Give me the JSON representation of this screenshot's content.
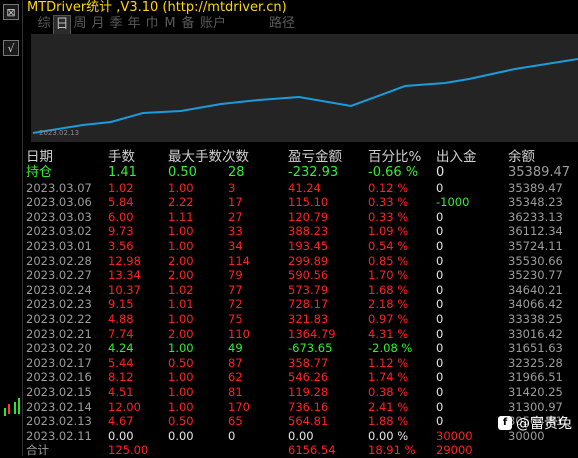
{
  "app_title": "MTDriver统计  ,V3.10 (http://mtdriver.cn)",
  "tabs": [
    "综",
    "日",
    "周",
    "月",
    "季",
    "年",
    "巾",
    "M",
    "备",
    "账户",
    "路径"
  ],
  "active_tab": "日",
  "chart": {
    "date_label": "2023.02.13"
  },
  "table": {
    "headers": [
      "日期",
      "手数",
      "最大手数",
      "次数",
      "盈亏金额",
      "百分比%",
      "出入金",
      "余额"
    ],
    "holding": {
      "label": "持仓",
      "lots": "1.41",
      "max_lots": "0.50",
      "count": "28",
      "pnl": "-232.93",
      "pct": "-0.66 %",
      "flow": "0",
      "balance": "35389.47"
    },
    "rows": [
      {
        "date": "2023.03.07",
        "lots": "1.02",
        "max_lots": "1.00",
        "count": "3",
        "pnl": "41.24",
        "pct": "0.12 %",
        "flow": "0",
        "balance": "35389.47"
      },
      {
        "date": "2023.03.06",
        "lots": "5.84",
        "max_lots": "2.22",
        "count": "17",
        "pnl": "115.10",
        "pct": "0.33 %",
        "flow": "-1000",
        "balance": "35348.23"
      },
      {
        "date": "2023.03.03",
        "lots": "6.00",
        "max_lots": "1.11",
        "count": "27",
        "pnl": "120.79",
        "pct": "0.33 %",
        "flow": "0",
        "balance": "36233.13"
      },
      {
        "date": "2023.03.02",
        "lots": "9.73",
        "max_lots": "1.00",
        "count": "33",
        "pnl": "388.23",
        "pct": "1.09 %",
        "flow": "0",
        "balance": "36112.34"
      },
      {
        "date": "2023.03.01",
        "lots": "3.56",
        "max_lots": "1.00",
        "count": "34",
        "pnl": "193.45",
        "pct": "0.54 %",
        "flow": "0",
        "balance": "35724.11"
      },
      {
        "date": "2023.02.28",
        "lots": "12.98",
        "max_lots": "2.00",
        "count": "114",
        "pnl": "299.89",
        "pct": "0.85 %",
        "flow": "0",
        "balance": "35530.66"
      },
      {
        "date": "2023.02.27",
        "lots": "13.34",
        "max_lots": "2.00",
        "count": "79",
        "pnl": "590.56",
        "pct": "1.70 %",
        "flow": "0",
        "balance": "35230.77"
      },
      {
        "date": "2023.02.24",
        "lots": "10.37",
        "max_lots": "1.02",
        "count": "77",
        "pnl": "573.79",
        "pct": "1.68 %",
        "flow": "0",
        "balance": "34640.21"
      },
      {
        "date": "2023.02.23",
        "lots": "9.15",
        "max_lots": "1.01",
        "count": "72",
        "pnl": "728.17",
        "pct": "2.18 %",
        "flow": "0",
        "balance": "34066.42"
      },
      {
        "date": "2023.02.22",
        "lots": "4.88",
        "max_lots": "1.00",
        "count": "75",
        "pnl": "321.83",
        "pct": "0.97 %",
        "flow": "0",
        "balance": "33338.25"
      },
      {
        "date": "2023.02.21",
        "lots": "7.74",
        "max_lots": "2.00",
        "count": "110",
        "pnl": "1364.79",
        "pct": "4.31 %",
        "flow": "0",
        "balance": "33016.42"
      },
      {
        "date": "2023.02.20",
        "lots": "4.24",
        "max_lots": "1.00",
        "count": "49",
        "pnl": "-673.65",
        "pct": "-2.08 %",
        "flow": "0",
        "balance": "31651.63"
      },
      {
        "date": "2023.02.17",
        "lots": "5.44",
        "max_lots": "0.50",
        "count": "87",
        "pnl": "358.77",
        "pct": "1.12 %",
        "flow": "0",
        "balance": "32325.28"
      },
      {
        "date": "2023.02.16",
        "lots": "8.12",
        "max_lots": "1.00",
        "count": "62",
        "pnl": "546.26",
        "pct": "1.74 %",
        "flow": "0",
        "balance": "31966.51"
      },
      {
        "date": "2023.02.15",
        "lots": "4.51",
        "max_lots": "1.00",
        "count": "81",
        "pnl": "119.28",
        "pct": "0.38 %",
        "flow": "0",
        "balance": "31420.25"
      },
      {
        "date": "2023.02.14",
        "lots": "12.00",
        "max_lots": "1.00",
        "count": "170",
        "pnl": "736.16",
        "pct": "2.41 %",
        "flow": "0",
        "balance": "31300.97"
      },
      {
        "date": "2023.02.13",
        "lots": "4.67",
        "max_lots": "0.50",
        "count": "65",
        "pnl": "564.81",
        "pct": "1.88 %",
        "flow": "0",
        "balance": "30564.81"
      },
      {
        "date": "2023.02.11",
        "lots": "0.00",
        "max_lots": "0.00",
        "count": "0",
        "pnl": "0.00",
        "pct": "0.00 %",
        "flow": "30000",
        "balance": "30000"
      }
    ],
    "total": {
      "label": "合计",
      "lots": "125.00",
      "pnl": "6156.54",
      "pct": "18.91 %",
      "flow": "29000"
    }
  },
  "watermark": "@富贵兔",
  "colors": {
    "title": "#ffd800",
    "positive": "#ff2222",
    "negative": "#33ee33",
    "line": "#1a9cdc",
    "chart_bg": "#242424"
  }
}
